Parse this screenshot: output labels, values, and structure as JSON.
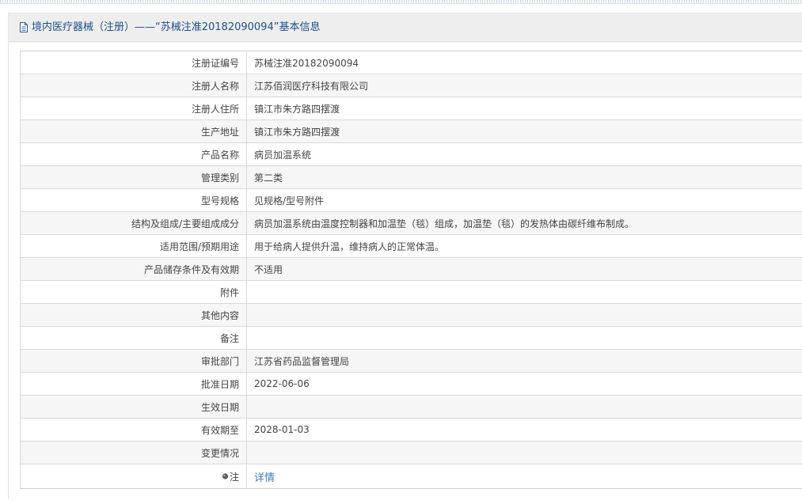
{
  "header": {
    "icon": "document-icon",
    "title": "境内医疗器械（注册）——“苏械注准20182090094”基本信息"
  },
  "rows": [
    {
      "label": "注册证编号",
      "value": "苏械注准20182090094"
    },
    {
      "label": "注册人名称",
      "value": "江苏佰润医疗科技有限公司"
    },
    {
      "label": "注册人住所",
      "value": "镇江市朱方路四摆渡"
    },
    {
      "label": "生产地址",
      "value": "镇江市朱方路四摆渡"
    },
    {
      "label": "产品名称",
      "value": "病员加温系统"
    },
    {
      "label": "管理类别",
      "value": "第二类"
    },
    {
      "label": "型号规格",
      "value": "见规格/型号附件"
    },
    {
      "label": "结构及组成/主要组成成分",
      "value": "病员加温系统由温度控制器和加温垫（毯）组成，加温垫（毯）的发热体由碳纤维布制成。"
    },
    {
      "label": "适用范围/预期用途",
      "value": "用于给病人提供升温，维持病人的正常体温。"
    },
    {
      "label": "产品储存条件及有效期",
      "value": "不适用"
    },
    {
      "label": "附件",
      "value": ""
    },
    {
      "label": "其他内容",
      "value": ""
    },
    {
      "label": "备注",
      "value": ""
    },
    {
      "label": "审批部门",
      "value": "江苏省药品监督管理局"
    },
    {
      "label": "批准日期",
      "value": "2022-06-06"
    },
    {
      "label": "生效日期",
      "value": ""
    },
    {
      "label": "有效期至",
      "value": "2028-01-03"
    },
    {
      "label": "变更情况",
      "value": ""
    }
  ],
  "note_row": {
    "icon": "bulb-icon",
    "label": "注",
    "link_text": "详情"
  },
  "colors": {
    "header_text": "#1d4f8d",
    "link": "#3a7ebf",
    "row_alt": "#f6f6f6",
    "border": "#dadada"
  }
}
